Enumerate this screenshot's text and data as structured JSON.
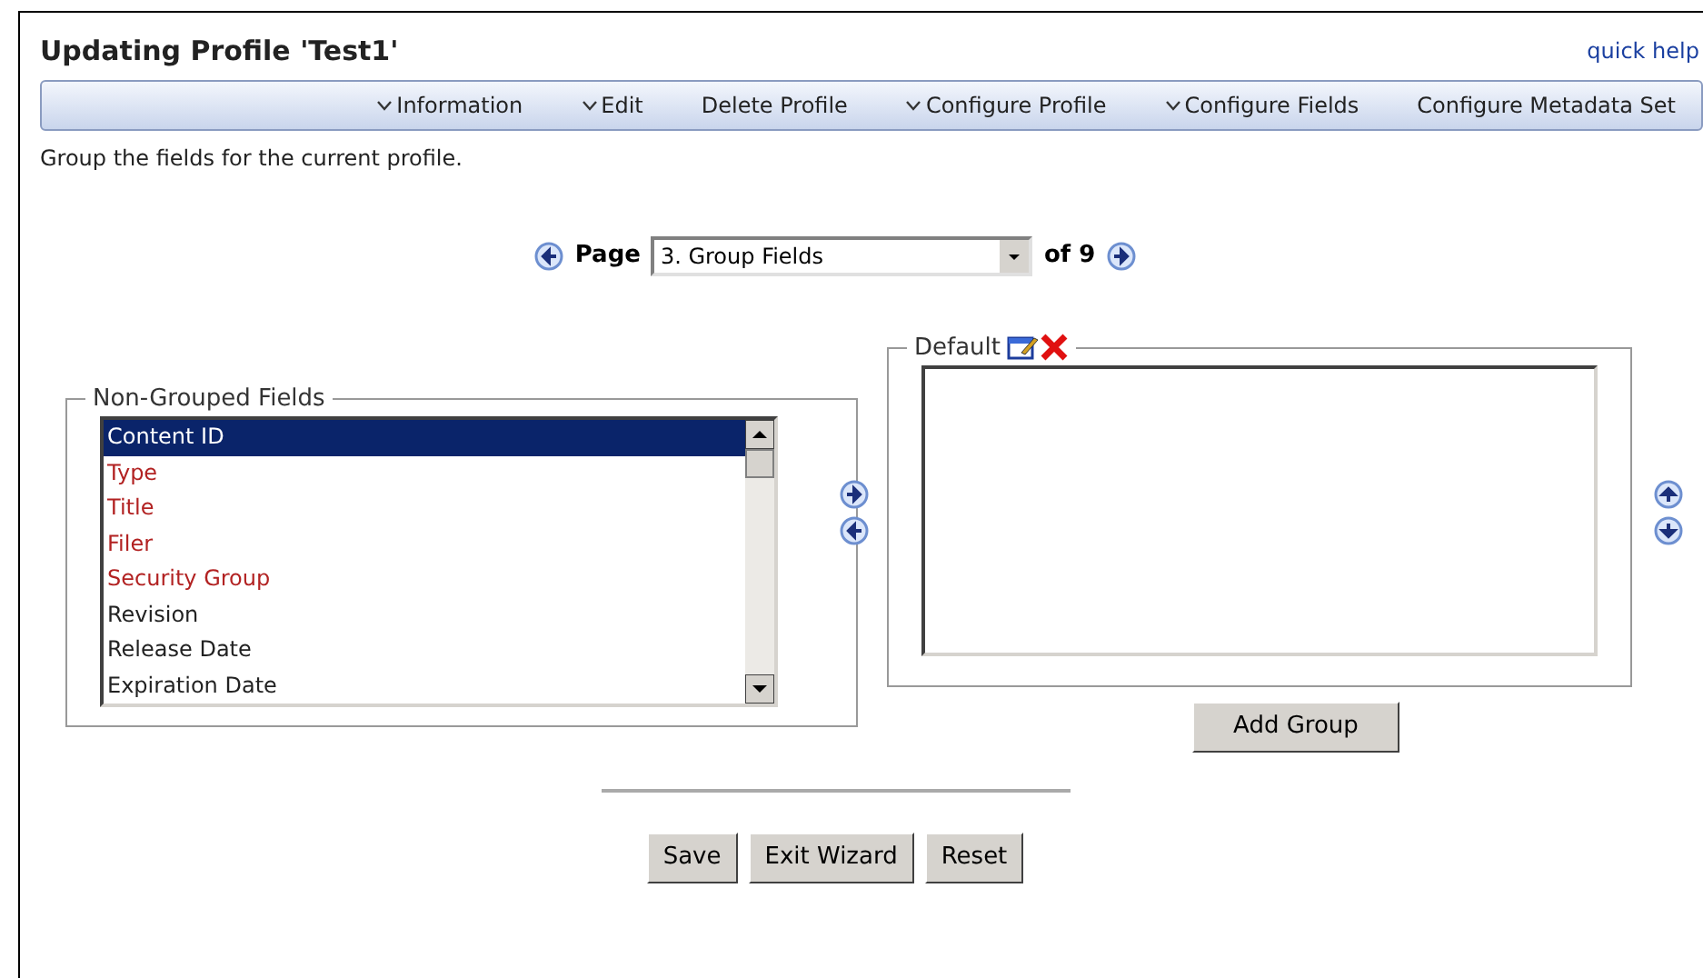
{
  "title": "Updating Profile 'Test1'",
  "quick_help": "quick help",
  "menu": [
    {
      "label": "Information",
      "dropdown": true
    },
    {
      "label": "Edit",
      "dropdown": true
    },
    {
      "label": "Delete Profile",
      "dropdown": false
    },
    {
      "label": "Configure Profile",
      "dropdown": true
    },
    {
      "label": "Configure Fields",
      "dropdown": true
    },
    {
      "label": "Configure Metadata Set",
      "dropdown": false
    }
  ],
  "description": "Group the fields for the current profile.",
  "pager": {
    "label": "Page",
    "value": "3. Group Fields",
    "of": "of 9"
  },
  "non_grouped": {
    "legend": "Non-Grouped Fields",
    "fields": [
      {
        "label": "Content ID",
        "required": false,
        "selected": true
      },
      {
        "label": "Type",
        "required": true,
        "selected": false
      },
      {
        "label": "Title",
        "required": true,
        "selected": false
      },
      {
        "label": "Filer",
        "required": true,
        "selected": false
      },
      {
        "label": "Security Group",
        "required": true,
        "selected": false
      },
      {
        "label": "Revision",
        "required": false,
        "selected": false
      },
      {
        "label": "Release Date",
        "required": false,
        "selected": false
      },
      {
        "label": "Expiration Date",
        "required": false,
        "selected": false
      }
    ]
  },
  "group": {
    "legend": "Default",
    "add_button": "Add Group"
  },
  "buttons": [
    "Save",
    "Exit Wizard",
    "Reset"
  ]
}
